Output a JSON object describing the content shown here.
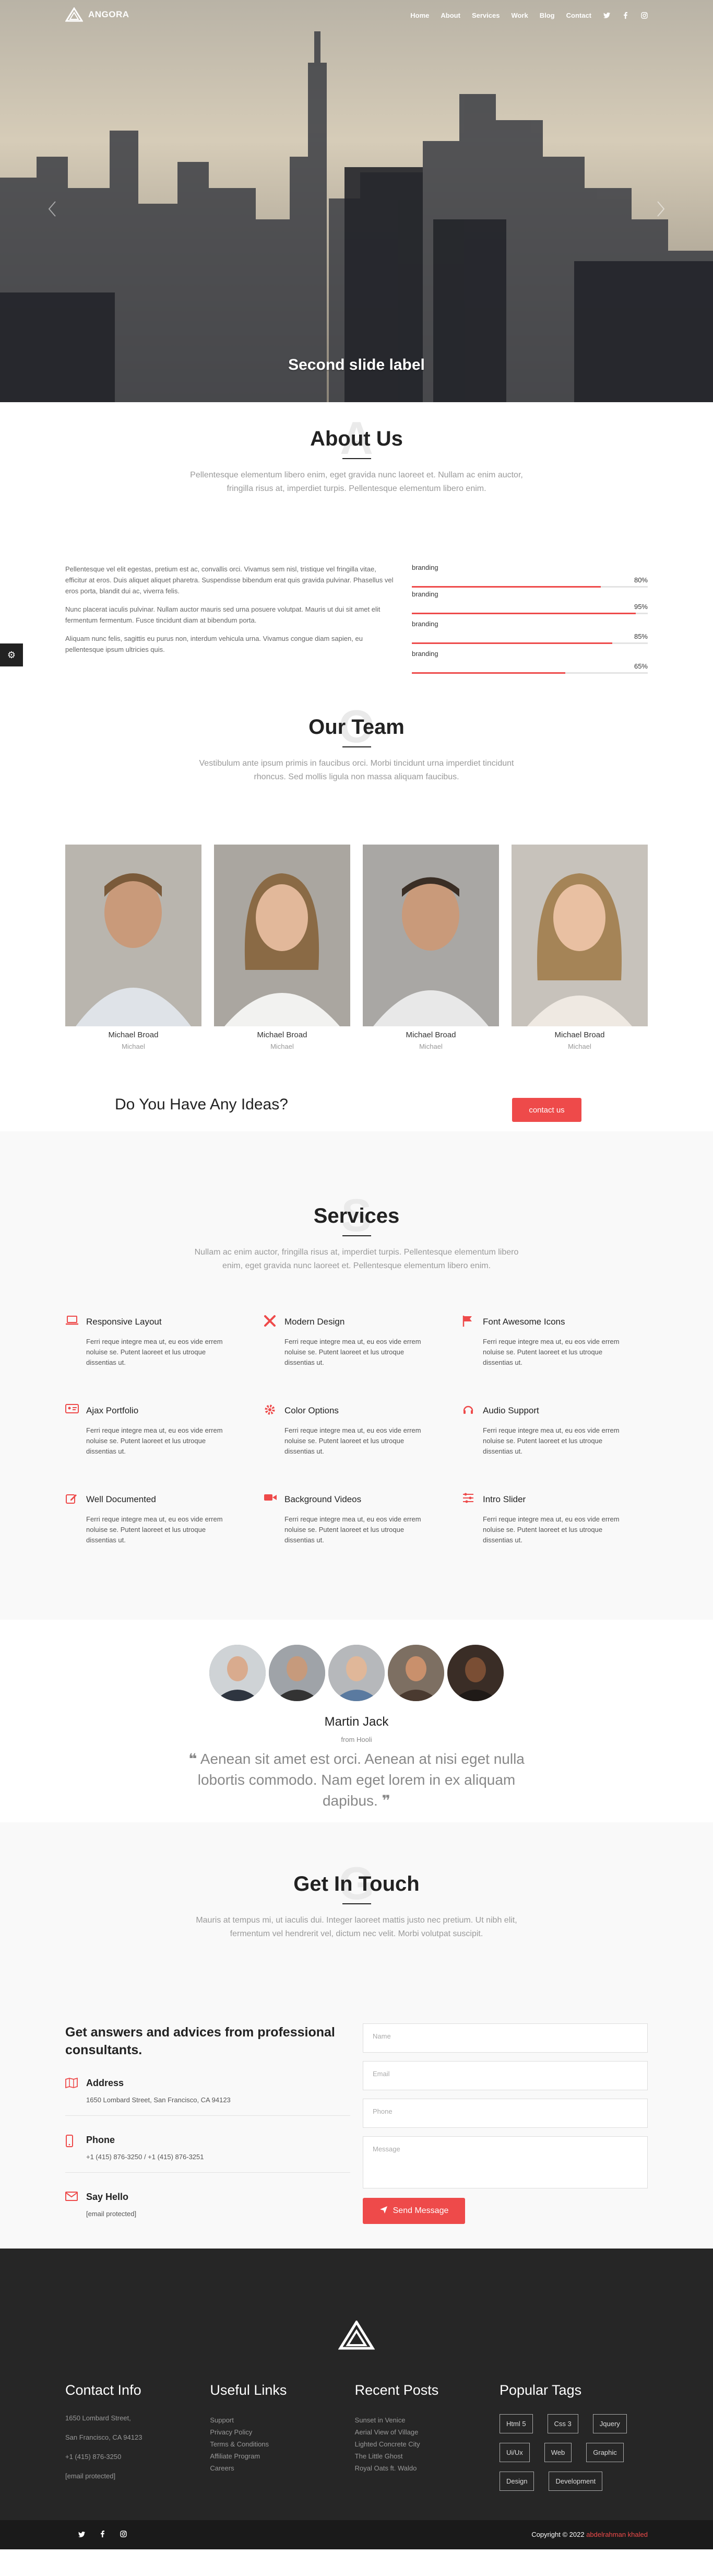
{
  "brand": {
    "name": "ANGORA"
  },
  "nav": {
    "items": [
      "Home",
      "About",
      "Services",
      "Work",
      "Blog",
      "Contact"
    ],
    "social": [
      "twitter-icon",
      "facebook-icon",
      "instagram-icon"
    ]
  },
  "hero": {
    "slide_label": "Second slide label"
  },
  "about": {
    "title": "About Us",
    "ghost": "A",
    "subtitle": "Pellentesque elementum libero enim, eget gravida nunc laoreet et. Nullam ac enim auctor, fringilla risus at, imperdiet turpis. Pellentesque elementum libero enim.",
    "paragraphs": [
      "Pellentesque vel elit egestas, pretium est ac, convallis orci. Vivamus sem nisl, tristique vel fringilla vitae, efficitur at eros. Duis aliquet aliquet pharetra. Suspendisse bibendum erat quis gravida pulvinar. Phasellus vel eros porta, blandit dui ac, viverra felis.",
      "Nunc placerat iaculis pulvinar. Nullam auctor mauris sed urna posuere volutpat. Mauris ut dui sit amet elit fermentum fermentum. Fusce tincidunt diam at bibendum porta.",
      "Aliquam nunc felis, sagittis eu purus non, interdum vehicula urna. Vivamus congue diam sapien, eu pellentesque ipsum ultricies quis."
    ],
    "skills": [
      {
        "label": "branding",
        "value": "80%",
        "pct": 80
      },
      {
        "label": "branding",
        "value": "95%",
        "pct": 95
      },
      {
        "label": "branding",
        "value": "85%",
        "pct": 85
      },
      {
        "label": "branding",
        "value": "65%",
        "pct": 65
      }
    ]
  },
  "team": {
    "title": "Our Team",
    "ghost": "O",
    "subtitle": "Vestibulum ante ipsum primis in faucibus orci. Morbi tincidunt urna imperdiet tincidunt rhoncus. Sed mollis ligula non massa aliquam faucibus.",
    "members": [
      {
        "name": "Michael Broad",
        "role": "Michael"
      },
      {
        "name": "Michael Broad",
        "role": "Michael"
      },
      {
        "name": "Michael Broad",
        "role": "Michael"
      },
      {
        "name": "Michael Broad",
        "role": "Michael"
      }
    ]
  },
  "ideas": {
    "text": "Do You Have Any Ideas?",
    "button": "contact us"
  },
  "services": {
    "title": "Services",
    "ghost": "S",
    "subtitle": "Nullam ac enim auctor, fringilla risus at, imperdiet turpis. Pellentesque elementum libero enim, eget gravida nunc laoreet et. Pellentesque elementum libero enim.",
    "items": [
      {
        "title": "Responsive Layout",
        "icon": "laptop-icon",
        "text": "Ferri reque integre mea ut, eu eos vide errem noluise se. Putent laoreet et lus utroque dissentias ut."
      },
      {
        "title": "Modern Design",
        "icon": "tools-icon",
        "text": "Ferri reque integre mea ut, eu eos vide errem noluise se. Putent laoreet et lus utroque dissentias ut."
      },
      {
        "title": "Font Awesome Icons",
        "icon": "flag-icon",
        "text": "Ferri reque integre mea ut, eu eos vide errem noluise se. Putent laoreet et lus utroque dissentias ut."
      },
      {
        "title": "Ajax Portfolio",
        "icon": "id-card-icon",
        "text": "Ferri reque integre mea ut, eu eos vide errem noluise se. Putent laoreet et lus utroque dissentias ut."
      },
      {
        "title": "Color Options",
        "icon": "gear-icon",
        "text": "Ferri reque integre mea ut, eu eos vide errem noluise se. Putent laoreet et lus utroque dissentias ut."
      },
      {
        "title": "Audio Support",
        "icon": "headset-icon",
        "text": "Ferri reque integre mea ut, eu eos vide errem noluise se. Putent laoreet et lus utroque dissentias ut."
      },
      {
        "title": "Well Documented",
        "icon": "edit-icon",
        "text": "Ferri reque integre mea ut, eu eos vide errem noluise se. Putent laoreet et lus utroque dissentias ut."
      },
      {
        "title": "Background Videos",
        "icon": "video-icon",
        "text": "Ferri reque integre mea ut, eu eos vide errem noluise se. Putent laoreet et lus utroque dissentias ut."
      },
      {
        "title": "Intro Slider",
        "icon": "sliders-icon",
        "text": "Ferri reque integre mea ut, eu eos vide errem noluise se. Putent laoreet et lus utroque dissentias ut."
      }
    ]
  },
  "testimonial": {
    "name": "Martin Jack",
    "from": "from Hooli",
    "quote": "Aenean sit amet est orci. Aenean at nisi eget nulla lobortis commodo. Nam eget lorem in ex aliquam dapibus."
  },
  "contact": {
    "title": "Get In Touch",
    "ghost": "G",
    "subtitle": "Mauris at tempus mi, ut iaculis dui. Integer laoreet mattis justo nec pretium. Ut nibh elit, fermentum vel hendrerit vel, dictum nec velit. Morbi volutpat suscipit.",
    "heading": "Get answers and advices from professional consultants.",
    "address_label": "Address",
    "address": "1650 Lombard Street, San Francisco, CA 94123",
    "phone_label": "Phone",
    "phone": "+1 (415) 876-3250 / +1 (415) 876-3251",
    "hello_label": "Say Hello",
    "email": "[email protected]",
    "form": {
      "name": "Name",
      "email": "Email",
      "phone": "Phone",
      "message": "Message",
      "send": "Send Message"
    }
  },
  "footer": {
    "contact_title": "Contact Info",
    "contact_lines": [
      "1650 Lombard Street,",
      "San Francisco, CA 94123",
      "+1 (415) 876-3250",
      "[email protected]"
    ],
    "links_title": "Useful Links",
    "links": [
      "Support",
      "Privacy Policy",
      "Terms & Conditions",
      "Affiliate Program",
      "Careers"
    ],
    "posts_title": "Recent Posts",
    "posts": [
      "Sunset in Venice",
      "Aerial View of Village",
      "Lighted Concrete City",
      "The Little Ghost",
      "Royal Oats ft. Waldo"
    ],
    "tags_title": "Popular Tags",
    "tags": [
      "Html 5",
      "Css 3",
      "Jquery",
      "Ui/Ux",
      "Web",
      "Graphic",
      "Design",
      "Development"
    ],
    "copyright": "Copyright © 2022",
    "author": "abdelrahman khaled"
  },
  "colors": {
    "accent": "#ee4a4a",
    "dark": "#262626"
  }
}
